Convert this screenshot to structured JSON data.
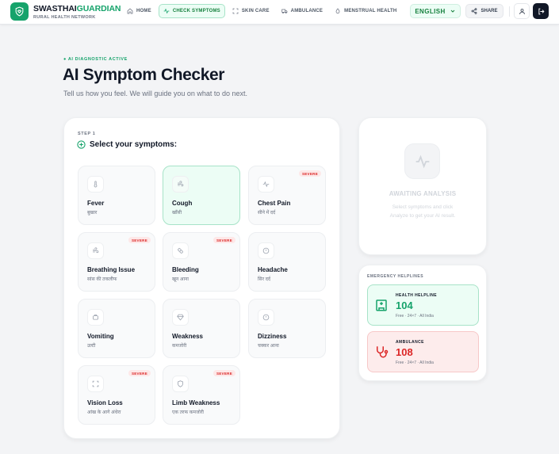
{
  "brand": {
    "name_part1": "SWASTHAI",
    "name_part2": "GUARDIAN",
    "tagline": "RURAL HEALTH NETWORK"
  },
  "nav": {
    "links": [
      {
        "label": "HOME",
        "icon": "home-icon",
        "active": false
      },
      {
        "label": "CHECK SYMPTOMS",
        "icon": "pulse-icon",
        "active": true
      },
      {
        "label": "SKIN CARE",
        "icon": "scan-icon",
        "active": false
      },
      {
        "label": "AMBULANCE",
        "icon": "truck-icon",
        "active": false
      },
      {
        "label": "MENSTRUAL HEALTH",
        "icon": "droplet-icon",
        "active": false
      }
    ],
    "language": "ENGLISH",
    "share": "SHARE"
  },
  "header": {
    "status": "AI DIAGNOSTIC ACTIVE",
    "title": "AI Symptom Checker",
    "subtitle": "Tell us how you feel. We will guide you on what to do next."
  },
  "symptoms": {
    "step": "STEP 1",
    "heading": "Select your symptoms:",
    "severe_label": "SEVERE",
    "items": [
      {
        "name": "Fever",
        "hindi": "बुखार",
        "severe": false,
        "selected": false,
        "icon": "thermometer-icon"
      },
      {
        "name": "Cough",
        "hindi": "खाँसी",
        "severe": false,
        "selected": true,
        "icon": "wind-icon"
      },
      {
        "name": "Chest Pain",
        "hindi": "सीने में दर्द",
        "severe": true,
        "selected": false,
        "icon": "activity-icon"
      },
      {
        "name": "Breathing Issue",
        "hindi": "सांस की तकलीफ",
        "severe": true,
        "selected": false,
        "icon": "wind-icon"
      },
      {
        "name": "Bleeding",
        "hindi": "खून आना",
        "severe": true,
        "selected": false,
        "icon": "bandage-icon"
      },
      {
        "name": "Headache",
        "hindi": "सिर दर्द",
        "severe": false,
        "selected": false,
        "icon": "alert-circle-icon"
      },
      {
        "name": "Vomiting",
        "hindi": "उल्टी",
        "severe": false,
        "selected": false,
        "icon": "stomach-icon"
      },
      {
        "name": "Weakness",
        "hindi": "कमजोरी",
        "severe": false,
        "selected": false,
        "icon": "gem-icon"
      },
      {
        "name": "Dizziness",
        "hindi": "चक्कर आना",
        "severe": false,
        "selected": false,
        "icon": "alert-circle-icon"
      },
      {
        "name": "Vision Loss",
        "hindi": "आंख के आगे अंधेरा",
        "severe": true,
        "selected": false,
        "icon": "focus-icon"
      },
      {
        "name": "Limb Weakness",
        "hindi": "एक तरफ कमजोरी",
        "severe": true,
        "selected": false,
        "icon": "shield-icon"
      }
    ]
  },
  "analysis": {
    "title": "AWAITING ANALYSIS",
    "description": "Select symptoms and click Analyze to get your AI result."
  },
  "helplines": {
    "title": "EMERGENCY HELPLINES",
    "items": [
      {
        "label": "HEALTH HELPLINE",
        "number": "104",
        "meta": "Free · 24×7 · All India",
        "color": "#16a36b",
        "icon": "hospital-icon"
      },
      {
        "label": "AMBULANCE",
        "number": "108",
        "meta": "Free · 24×7 · All India",
        "color": "#dc2626",
        "icon": "stethoscope-icon"
      }
    ]
  }
}
